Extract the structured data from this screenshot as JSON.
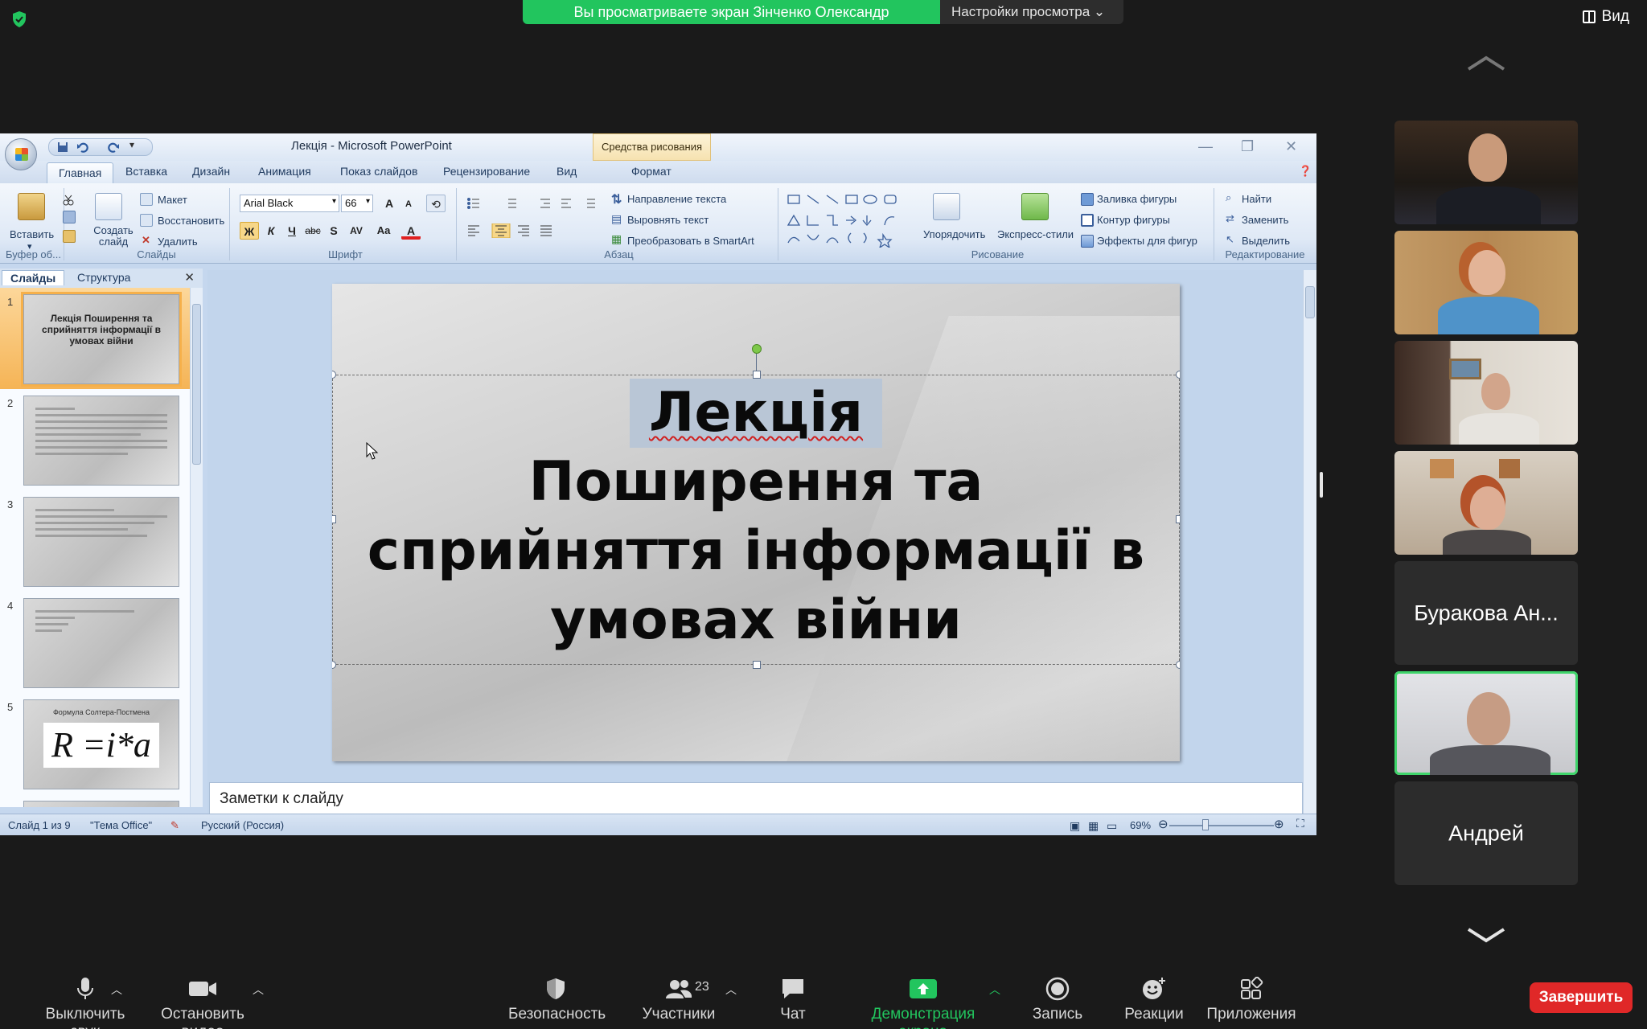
{
  "zoom": {
    "share_banner": "Вы просматриваете экран Зінченко Олександр",
    "view_settings": "Настройки просмотра",
    "view_button": "Вид",
    "participants": [
      {
        "name": "",
        "camera": true
      },
      {
        "name": "",
        "camera": true
      },
      {
        "name": "",
        "camera": true
      },
      {
        "name": "",
        "camera": true
      },
      {
        "name": "Буракова Ан...",
        "camera": false
      },
      {
        "name": "",
        "camera": true,
        "active_speaker": true
      },
      {
        "name": "Андрей",
        "camera": false
      }
    ],
    "toolbar": {
      "mute": "Выключить звук",
      "stop_video": "Остановить видео",
      "security": "Безопасность",
      "participants": "Участники",
      "participants_count": "23",
      "chat": "Чат",
      "share_screen": "Демонстрация экрана",
      "record": "Запись",
      "reactions": "Реакции",
      "apps": "Приложения",
      "end": "Завершить"
    },
    "colors": {
      "share_green": "#22c55e",
      "end_red": "#e02828",
      "speaker_outline": "#3fd46a"
    }
  },
  "ppt": {
    "window_title": "Лекція - Microsoft PowerPoint",
    "contextual_tab": "Средства рисования",
    "tabs": [
      "Главная",
      "Вставка",
      "Дизайн",
      "Анимация",
      "Показ слайдов",
      "Рецензирование",
      "Вид",
      "Формат"
    ],
    "ribbon": {
      "clipboard": {
        "paste": "Вставить",
        "label": "Буфер об..."
      },
      "slides": {
        "new_slide": "Создать слайд",
        "layout": "Макет",
        "reset": "Восстановить",
        "delete": "Удалить",
        "label": "Слайды"
      },
      "font": {
        "font_name": "Arial Black",
        "font_size": "66",
        "bold": "Ж",
        "italic": "К",
        "underline": "Ч",
        "strike": "abc",
        "shadow": "S",
        "spacing": "AV",
        "case": "Aa",
        "color": "A",
        "grow": "A",
        "shrink": "A",
        "label": "Шрифт"
      },
      "paragraph": {
        "text_direction": "Направление текста",
        "align_text": "Выровнять текст",
        "smartart": "Преобразовать в SmartArt",
        "label": "Абзац"
      },
      "drawing": {
        "arrange": "Упорядочить",
        "quick_styles": "Экспресс-стили",
        "shape_fill": "Заливка фигуры",
        "shape_outline": "Контур фигуры",
        "shape_effects": "Эффекты для фигур",
        "label": "Рисование"
      },
      "editing": {
        "find": "Найти",
        "replace": "Заменить",
        "select": "Выделить",
        "label": "Редактирование"
      }
    },
    "pane_tabs": [
      "Слайды",
      "Структура"
    ],
    "thumbnails": [
      {
        "num": "1",
        "text": "Лекція Поширення та сприйняття інформації в умовах війни"
      },
      {
        "num": "2",
        "text": ""
      },
      {
        "num": "3",
        "text": ""
      },
      {
        "num": "4",
        "text": ""
      },
      {
        "num": "5",
        "text": "R =i*a",
        "caption": "Формула Солтера-Постмена"
      }
    ],
    "slide": {
      "line1": "Лекція",
      "line2": "Поширення та",
      "line3": "сприйняття інформації в",
      "line4": "умовах війни"
    },
    "notes_placeholder": "Заметки к слайду",
    "status": {
      "slide_counter": "Слайд 1 из 9",
      "theme": "\"Тема Office\"",
      "language": "Русский (Россия)",
      "zoom": "69%"
    }
  }
}
